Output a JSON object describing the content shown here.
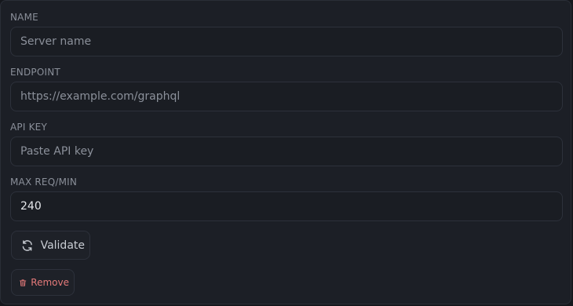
{
  "form": {
    "fields": [
      {
        "label": "NAME",
        "value": "",
        "placeholder": "Server name"
      },
      {
        "label": "ENDPOINT",
        "value": "",
        "placeholder": "https://example.com/graphql"
      },
      {
        "label": "API KEY",
        "value": "",
        "placeholder": "Paste API key"
      },
      {
        "label": "MAX REQ/MIN",
        "value": "240",
        "placeholder": ""
      }
    ],
    "validate_label": "Validate",
    "remove_label": "Remove"
  },
  "icons": {
    "validate": "refresh-icon",
    "remove": "trash-icon"
  },
  "colors": {
    "background": "#1c1f26",
    "danger": "#e57a7a"
  }
}
